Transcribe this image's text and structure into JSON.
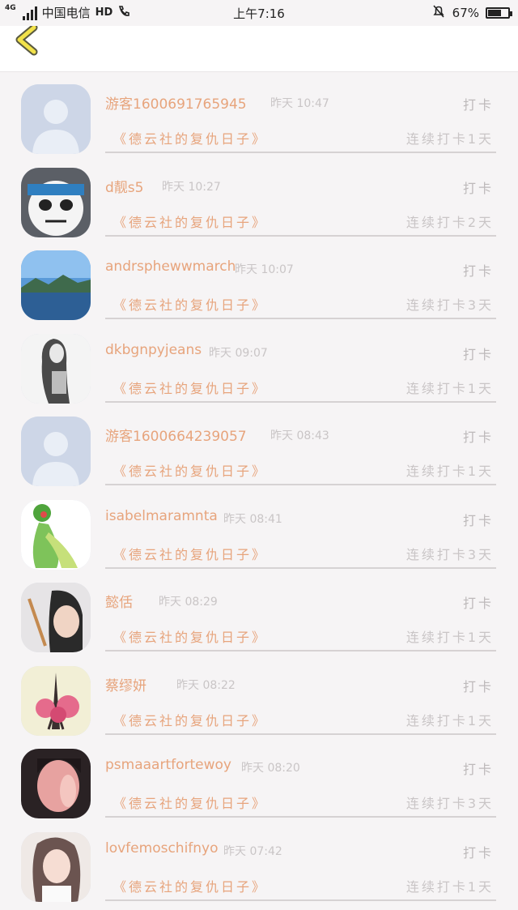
{
  "status_bar": {
    "network": "4G",
    "carrier": "中国电信",
    "hd": "HD",
    "time": "上午7:16",
    "battery": "67%",
    "battery_level": 0.67
  },
  "header": {
    "back_icon": "chevron-left-icon"
  },
  "accent_color": "#e7a47c",
  "entries": [
    {
      "name": "游客1600691765945",
      "time": "昨天 10:47",
      "action": "打卡",
      "book": "《德云社的复仇日子》",
      "streak": "连续打卡1天",
      "avatar": "default-avatar-icon"
    },
    {
      "name": "d靓s5",
      "time": "昨天 10:27",
      "action": "打卡",
      "book": "《德云社的复仇日子》",
      "streak": "连续打卡2天",
      "avatar": "panda-avatar"
    },
    {
      "name": "andrsphewwmarch",
      "time": "昨天 10:07",
      "action": "打卡",
      "book": "《德云社的复仇日子》",
      "streak": "连续打卡3天",
      "avatar": "lake-avatar"
    },
    {
      "name": "dkbgnpyjeans",
      "time": "昨天 09:07",
      "action": "打卡",
      "book": "《德云社的复仇日子》",
      "streak": "连续打卡1天",
      "avatar": "sketch-girl-avatar"
    },
    {
      "name": "游客1600664239057",
      "time": "昨天 08:43",
      "action": "打卡",
      "book": "《德云社的复仇日子》",
      "streak": "连续打卡1天",
      "avatar": "default-avatar-icon"
    },
    {
      "name": "isabelmaramnta",
      "time": "昨天 08:41",
      "action": "打卡",
      "book": "《德云社的复仇日子》",
      "streak": "连续打卡3天",
      "avatar": "gardevoir-avatar"
    },
    {
      "name": "懿佸",
      "time": "昨天 08:29",
      "action": "打卡",
      "book": "《德云社的复仇日子》",
      "streak": "连续打卡1天",
      "avatar": "boy-avatar"
    },
    {
      "name": "蔡缪妍",
      "time": "昨天 08:22",
      "action": "打卡",
      "book": "《德云社的复仇日子》",
      "streak": "连续打卡1天",
      "avatar": "eiffel-tower-avatar"
    },
    {
      "name": "psmaaartfortewoy",
      "time": "昨天 08:20",
      "action": "打卡",
      "book": "《德云社的复仇日子》",
      "streak": "连续打卡3天",
      "avatar": "girl-portrait-avatar"
    },
    {
      "name": "lovfemoschifnyo",
      "time": "昨天 07:42",
      "action": "打卡",
      "book": "《德云社的复仇日子》",
      "streak": "连续打卡1天",
      "avatar": "girl-avatar"
    }
  ]
}
